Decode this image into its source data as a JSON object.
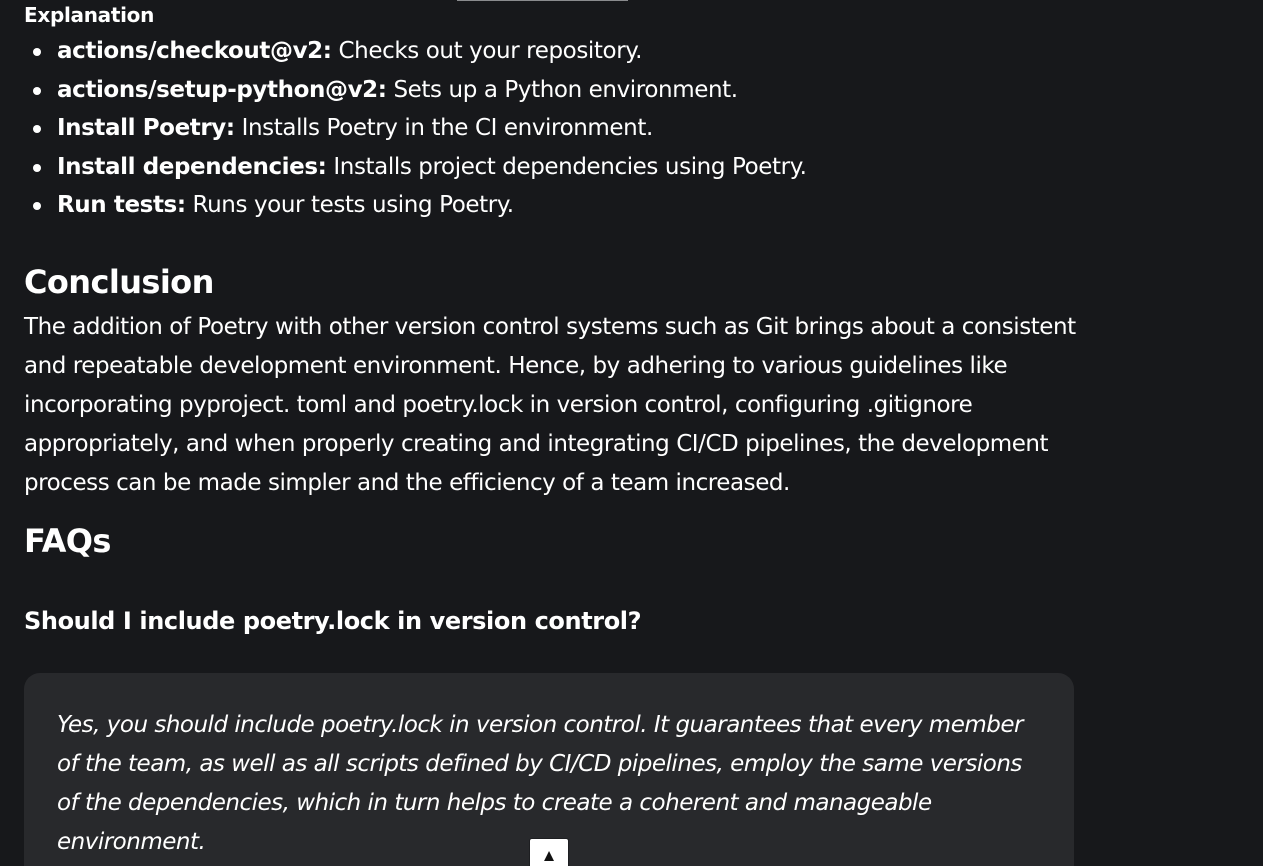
{
  "explanation": {
    "heading": "Explanation",
    "items": [
      {
        "term": "actions/checkout@v2:",
        "desc": " Checks out your repository."
      },
      {
        "term": "actions/setup-python@v2:",
        "desc": " Sets up a Python environment."
      },
      {
        "term": "Install Poetry:",
        "desc": " Installs Poetry in the CI environment."
      },
      {
        "term": "Install dependencies:",
        "desc": " Installs project dependencies using Poetry."
      },
      {
        "term": "Run tests:",
        "desc": " Runs your tests using Poetry."
      }
    ]
  },
  "conclusion": {
    "heading": "Conclusion",
    "text": "The addition of Poetry with other version control systems such as Git brings about a consistent and repeatable development environment. Hence, by adhering to various guidelines like incorporating pyproject. toml and poetry.lock in version control, configuring .gitignore appropriately, and when properly creating and integrating CI/CD pipelines, the development process can be made simpler and the efficiency of a team increased."
  },
  "faqs": {
    "heading": "FAQs",
    "question": "Should I include poetry.lock in version control?",
    "answer": "Yes, you should include poetry.lock in version control. It guarantees that every member of the team, as well as all scripts defined by CI/CD pipelines, employ the same versions of the dependencies, which in turn helps to create a coherent and manageable environment."
  },
  "scroll_top": {
    "icon": "▲",
    "icon_name": "arrow-up-icon"
  },
  "colors": {
    "background": "#17181b",
    "card": "#28292c",
    "text": "#ffffff"
  }
}
